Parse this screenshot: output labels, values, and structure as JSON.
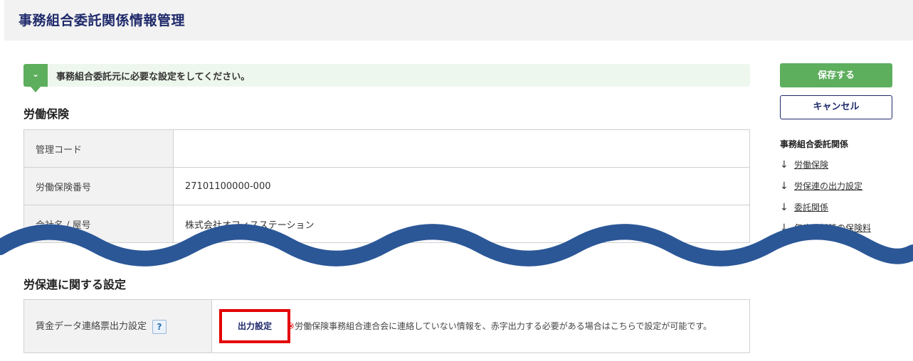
{
  "header": {
    "title": "事務組合委託関係情報管理"
  },
  "notice": {
    "text": "事務組合委託元に必要な設定をしてください。",
    "icon": "chevron-down-icon"
  },
  "labor_insurance": {
    "title": "労働保険",
    "rows": [
      {
        "label": "管理コード",
        "value": ""
      },
      {
        "label": "労働保険番号",
        "value": "27101100000-000"
      },
      {
        "label": "会社名 / 屋号",
        "value": "株式会社オフィスステーション"
      }
    ]
  },
  "rouhoren": {
    "title": "労保連に関する設定",
    "row_label": "賃金データ連絡票出力設定",
    "help": "?",
    "button_label": "出力設定",
    "note_mark": "※",
    "note": "労働保険事務組合連合会に連絡していない情報を、赤字出力する必要がある場合はこちらで設定が可能です。"
  },
  "side": {
    "save_label": "保存する",
    "cancel_label": "キャンセル",
    "heading": "事務組合委託関係",
    "links": [
      {
        "arrow": "↓",
        "label": "労働保険"
      },
      {
        "arrow": "↓",
        "label": "労保連の出力設定"
      },
      {
        "arrow": "↓",
        "label": "委託関係"
      },
      {
        "arrow": "↓",
        "label": "年度更新時の保険料"
      }
    ]
  },
  "colors": {
    "accent_green": "#5dae5d",
    "navy": "#1f2a6b",
    "wave": "#2b5797",
    "highlight_red": "#e30000"
  }
}
